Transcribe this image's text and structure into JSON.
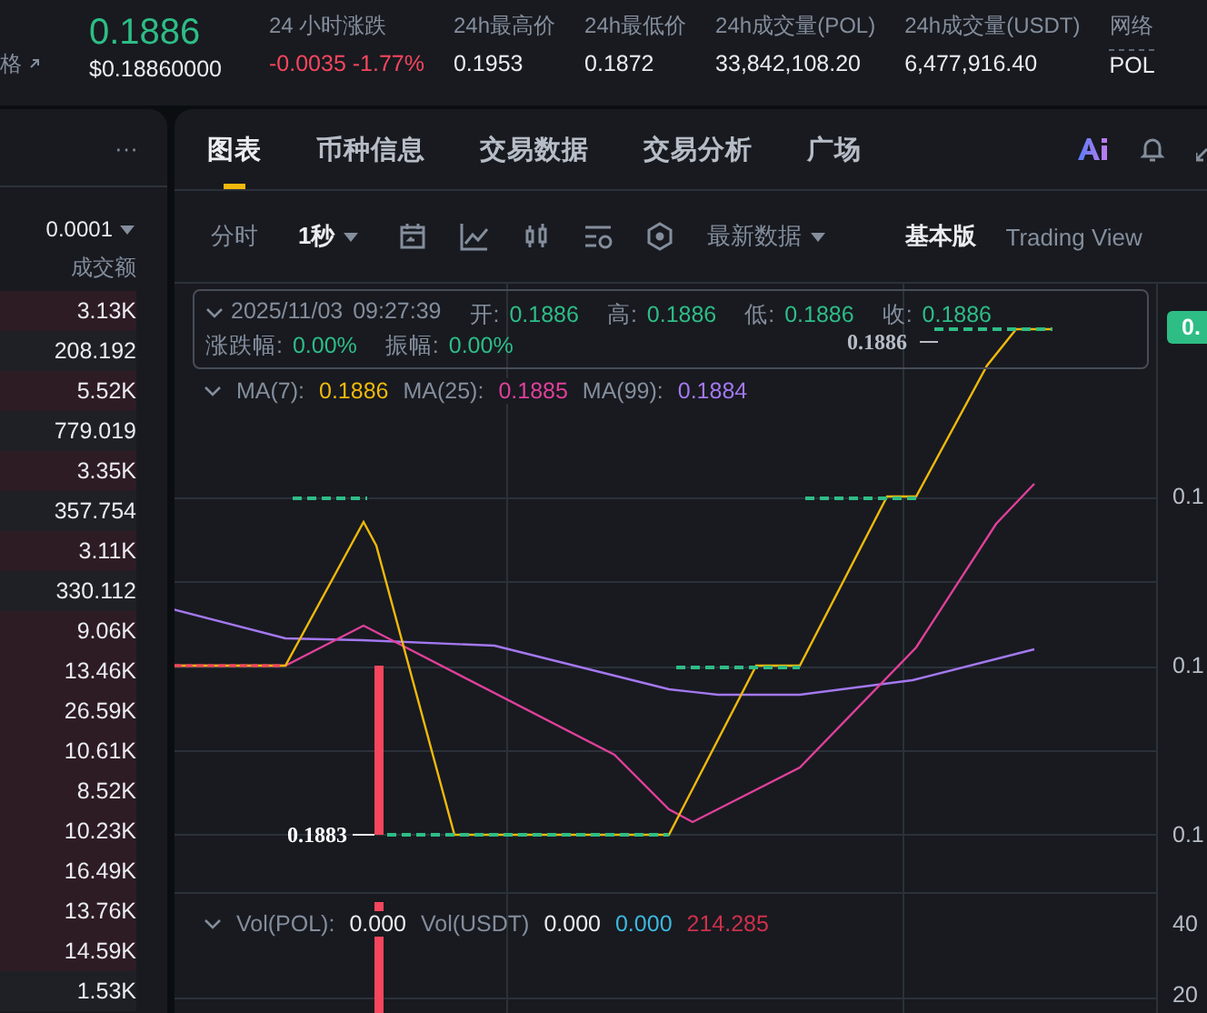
{
  "header": {
    "cut_label": "格",
    "price": "0.1886",
    "price_usd": "$0.18860000",
    "stats": [
      {
        "label": "24 小时涨跌",
        "value": "-0.0035 -1.77%",
        "kind": "down"
      },
      {
        "label": "24h最高价",
        "value": "0.1953",
        "kind": "plain"
      },
      {
        "label": "24h最低价",
        "value": "0.1872",
        "kind": "plain"
      },
      {
        "label": "24h成交量(POL)",
        "value": "33,842,108.20",
        "kind": "plain"
      },
      {
        "label": "24h成交量(USDT)",
        "value": "6,477,916.40",
        "kind": "plain"
      },
      {
        "label": "网络",
        "value": "POL",
        "kind": "dotted"
      }
    ]
  },
  "order_book": {
    "more": "···",
    "precision": "0.0001",
    "column": "成交额",
    "rows": [
      {
        "value": "3.13K",
        "kind": "sell"
      },
      {
        "value": "208.192",
        "kind": "dark"
      },
      {
        "value": "5.52K",
        "kind": "sell"
      },
      {
        "value": "779.019",
        "kind": "dark"
      },
      {
        "value": "3.35K",
        "kind": "sell"
      },
      {
        "value": "357.754",
        "kind": "dark"
      },
      {
        "value": "3.11K",
        "kind": "sell"
      },
      {
        "value": "330.112",
        "kind": "dark"
      },
      {
        "value": "9.06K",
        "kind": "sell"
      },
      {
        "value": "13.46K",
        "kind": "sell"
      },
      {
        "value": "26.59K",
        "kind": "sell"
      },
      {
        "value": "10.61K",
        "kind": "sell"
      },
      {
        "value": "8.52K",
        "kind": "sell"
      },
      {
        "value": "10.23K",
        "kind": "sell"
      },
      {
        "value": "16.49K",
        "kind": "sell"
      },
      {
        "value": "13.76K",
        "kind": "sell"
      },
      {
        "value": "14.59K",
        "kind": "sell"
      },
      {
        "value": "1.53K",
        "kind": "dark"
      }
    ]
  },
  "tabs": [
    {
      "label": "图表",
      "selected": true
    },
    {
      "label": "币种信息",
      "selected": false
    },
    {
      "label": "交易数据",
      "selected": false
    },
    {
      "label": "交易分析",
      "selected": false
    },
    {
      "label": "广场",
      "selected": false
    }
  ],
  "toolbar": {
    "time_line": "分时",
    "interval": "1秒",
    "data_mode": "最新数据",
    "views": [
      {
        "label": "基本版",
        "selected": true
      },
      {
        "label": "Trading View",
        "selected": false
      }
    ]
  },
  "ohlc": {
    "time": "2025/11/03 09:27:39",
    "fields": [
      {
        "label": "开:",
        "value": "0.1886"
      },
      {
        "label": "高:",
        "value": "0.1886"
      },
      {
        "label": "低:",
        "value": "0.1886"
      },
      {
        "label": "收:",
        "value": "0.1886"
      },
      {
        "label": "涨跌幅:",
        "value": "0.00%"
      },
      {
        "label": "振幅:",
        "value": "0.00%"
      }
    ]
  },
  "ma": [
    {
      "label": "MA(7):",
      "value": "0.1886",
      "color": "#f0b90b"
    },
    {
      "label": "MA(25):",
      "value": "0.1885",
      "color": "#e0409a"
    },
    {
      "label": "MA(99):",
      "value": "0.1884",
      "color": "#a478f0"
    }
  ],
  "chart": {
    "high_label": "0.1886",
    "low_label": "0.1883",
    "price_tag": "0.",
    "axis": [
      "0.1",
      "0.1",
      "0.1"
    ],
    "vol_axis": [
      "40",
      "20"
    ]
  },
  "volume": {
    "label": "Vol(POL):",
    "value": "0.000",
    "label2": "Vol(USDT)",
    "values": [
      {
        "value": "0.000",
        "color": "#eaecef"
      },
      {
        "value": "0.000",
        "color": "#3db8de"
      },
      {
        "value": "214.285",
        "color": "#cf304a"
      }
    ]
  }
}
